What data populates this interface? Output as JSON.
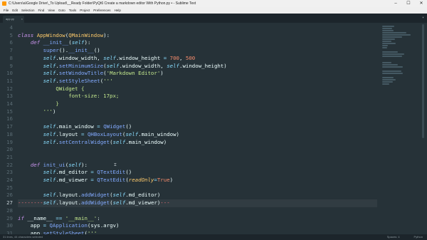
{
  "window": {
    "title": "C:\\Users\\a\\Google Drive\\_To Upload\\__Ready Folder\\PyQt6 Create a markdown editor With Python.py • - Sublime Text",
    "controls": [
      "–",
      "☐",
      "✕"
    ]
  },
  "menu": [
    "File",
    "Edit",
    "Selection",
    "Find",
    "View",
    "Goto",
    "Tools",
    "Project",
    "Preferences",
    "Help"
  ],
  "tab": {
    "label": "app.py"
  },
  "editor": {
    "lines": [
      {
        "n": "4",
        "t": [
          [
            "w",
            ""
          ]
        ]
      },
      {
        "n": "5",
        "t": [
          [
            "k",
            "class "
          ],
          [
            "c",
            "AppWindow"
          ],
          [
            "w",
            "("
          ],
          [
            "c",
            "QMainWindow"
          ],
          [
            "w",
            "):"
          ]
        ]
      },
      {
        "n": "6",
        "t": [
          [
            "w",
            "    "
          ],
          [
            "k",
            "def "
          ],
          [
            "f",
            "__init__"
          ],
          [
            "w",
            "("
          ],
          [
            "u",
            "self"
          ],
          [
            "w",
            "):"
          ]
        ]
      },
      {
        "n": "7",
        "t": [
          [
            "w",
            "        "
          ],
          [
            "f",
            "super"
          ],
          [
            "w",
            "()."
          ],
          [
            "f",
            "__init__"
          ],
          [
            "w",
            "()"
          ]
        ]
      },
      {
        "n": "8",
        "t": [
          [
            "w",
            "        "
          ],
          [
            "u",
            "self"
          ],
          [
            "w",
            ".window_width, "
          ],
          [
            "u",
            "self"
          ],
          [
            "w",
            ".window_height "
          ],
          [
            "p",
            "="
          ],
          [
            "w",
            " "
          ],
          [
            "n",
            "700"
          ],
          [
            "w",
            ", "
          ],
          [
            "n",
            "500"
          ]
        ]
      },
      {
        "n": "9",
        "t": [
          [
            "w",
            "        "
          ],
          [
            "u",
            "self"
          ],
          [
            "w",
            "."
          ],
          [
            "f",
            "setMinimumSize"
          ],
          [
            "w",
            "("
          ],
          [
            "u",
            "self"
          ],
          [
            "w",
            ".window_width, "
          ],
          [
            "u",
            "self"
          ],
          [
            "w",
            ".window_height)"
          ]
        ]
      },
      {
        "n": "10",
        "t": [
          [
            "w",
            "        "
          ],
          [
            "u",
            "self"
          ],
          [
            "w",
            "."
          ],
          [
            "f",
            "setWindowTitle"
          ],
          [
            "w",
            "("
          ],
          [
            "s",
            "'Markdown Editor'"
          ],
          [
            "w",
            ")"
          ]
        ]
      },
      {
        "n": "11",
        "t": [
          [
            "w",
            "        "
          ],
          [
            "u",
            "self"
          ],
          [
            "w",
            "."
          ],
          [
            "f",
            "setStyleSheet"
          ],
          [
            "w",
            "("
          ],
          [
            "s",
            "'''"
          ]
        ]
      },
      {
        "n": "12",
        "t": [
          [
            "s",
            "            QWidget {"
          ]
        ]
      },
      {
        "n": "13",
        "t": [
          [
            "s",
            "                font-size: 17px;"
          ]
        ]
      },
      {
        "n": "14",
        "t": [
          [
            "s",
            "            }"
          ]
        ]
      },
      {
        "n": "15",
        "t": [
          [
            "s",
            "        '''"
          ],
          [
            "w",
            ")"
          ]
        ]
      },
      {
        "n": "16",
        "t": [
          [
            "w",
            ""
          ]
        ]
      },
      {
        "n": "17",
        "t": [
          [
            "w",
            "        "
          ],
          [
            "u",
            "self"
          ],
          [
            "w",
            ".main_window "
          ],
          [
            "p",
            "="
          ],
          [
            "w",
            " "
          ],
          [
            "f",
            "QWidget"
          ],
          [
            "w",
            "()"
          ]
        ]
      },
      {
        "n": "18",
        "t": [
          [
            "w",
            "        "
          ],
          [
            "u",
            "self"
          ],
          [
            "w",
            ".layout "
          ],
          [
            "p",
            "="
          ],
          [
            "w",
            " "
          ],
          [
            "f",
            "QHBoxLayout"
          ],
          [
            "w",
            "("
          ],
          [
            "u",
            "self"
          ],
          [
            "w",
            ".main_window)"
          ]
        ]
      },
      {
        "n": "19",
        "t": [
          [
            "w",
            "        "
          ],
          [
            "u",
            "self"
          ],
          [
            "w",
            "."
          ],
          [
            "f",
            "setCentralWidget"
          ],
          [
            "w",
            "("
          ],
          [
            "u",
            "self"
          ],
          [
            "w",
            ".main_window)"
          ]
        ]
      },
      {
        "n": "20",
        "t": [
          [
            "w",
            ""
          ]
        ]
      },
      {
        "n": "21",
        "t": [
          [
            "w",
            ""
          ]
        ]
      },
      {
        "n": "22",
        "t": [
          [
            "w",
            "    "
          ],
          [
            "k",
            "def "
          ],
          [
            "f",
            "init_ui"
          ],
          [
            "w",
            "("
          ],
          [
            "u",
            "self"
          ],
          [
            "w",
            "):"
          ]
        ]
      },
      {
        "n": "23",
        "t": [
          [
            "w",
            "        "
          ],
          [
            "u",
            "self"
          ],
          [
            "w",
            ".md_editor "
          ],
          [
            "p",
            "="
          ],
          [
            "w",
            " "
          ],
          [
            "f",
            "QTextEdit"
          ],
          [
            "w",
            "()"
          ]
        ]
      },
      {
        "n": "24",
        "t": [
          [
            "w",
            "        "
          ],
          [
            "u",
            "self"
          ],
          [
            "w",
            ".md_viewer "
          ],
          [
            "p",
            "="
          ],
          [
            "w",
            " "
          ],
          [
            "f",
            "QTextEdit"
          ],
          [
            "w",
            "("
          ],
          [
            "a",
            "readOnly"
          ],
          [
            "p",
            "="
          ],
          [
            "n",
            "True"
          ],
          [
            "w",
            ")"
          ]
        ]
      },
      {
        "n": "25",
        "t": [
          [
            "w",
            ""
          ]
        ]
      },
      {
        "n": "26",
        "t": [
          [
            "w",
            "        "
          ],
          [
            "u",
            "self"
          ],
          [
            "w",
            ".layout."
          ],
          [
            "f",
            "addWidget"
          ],
          [
            "w",
            "("
          ],
          [
            "u",
            "self"
          ],
          [
            "w",
            ".md_editor)"
          ]
        ]
      },
      {
        "n": "27",
        "t": [
          [
            "m",
            "--------"
          ],
          [
            "u",
            "self"
          ],
          [
            "w",
            ".layout."
          ],
          [
            "f",
            "addWidget"
          ],
          [
            "w",
            "("
          ],
          [
            "u",
            "self"
          ],
          [
            "w",
            ".md_viewer)"
          ],
          [
            "m",
            "---"
          ]
        ],
        "current": true
      },
      {
        "n": "28",
        "t": [
          [
            "w",
            ""
          ]
        ]
      },
      {
        "n": "29",
        "t": [
          [
            "k",
            "if "
          ],
          [
            "w",
            "__name__ "
          ],
          [
            "p",
            "=="
          ],
          [
            "w",
            " "
          ],
          [
            "s",
            "'__main__'"
          ],
          [
            "w",
            ":"
          ]
        ]
      },
      {
        "n": "30",
        "t": [
          [
            "w",
            "    app "
          ],
          [
            "p",
            "="
          ],
          [
            "w",
            " "
          ],
          [
            "f",
            "QApplication"
          ],
          [
            "w",
            "(sys.argv)"
          ]
        ]
      },
      {
        "n": "31",
        "t": [
          [
            "w",
            "    app."
          ],
          [
            "f",
            "setStyleSheet"
          ],
          [
            "w",
            "("
          ],
          [
            "s",
            "'''"
          ]
        ]
      },
      {
        "n": "32",
        "t": [
          [
            "s",
            "        QWidget {"
          ]
        ]
      }
    ]
  },
  "status": {
    "left": "31 lines, 44 characters selected",
    "spaces": "Spaces: 4",
    "syntax": "Python"
  }
}
